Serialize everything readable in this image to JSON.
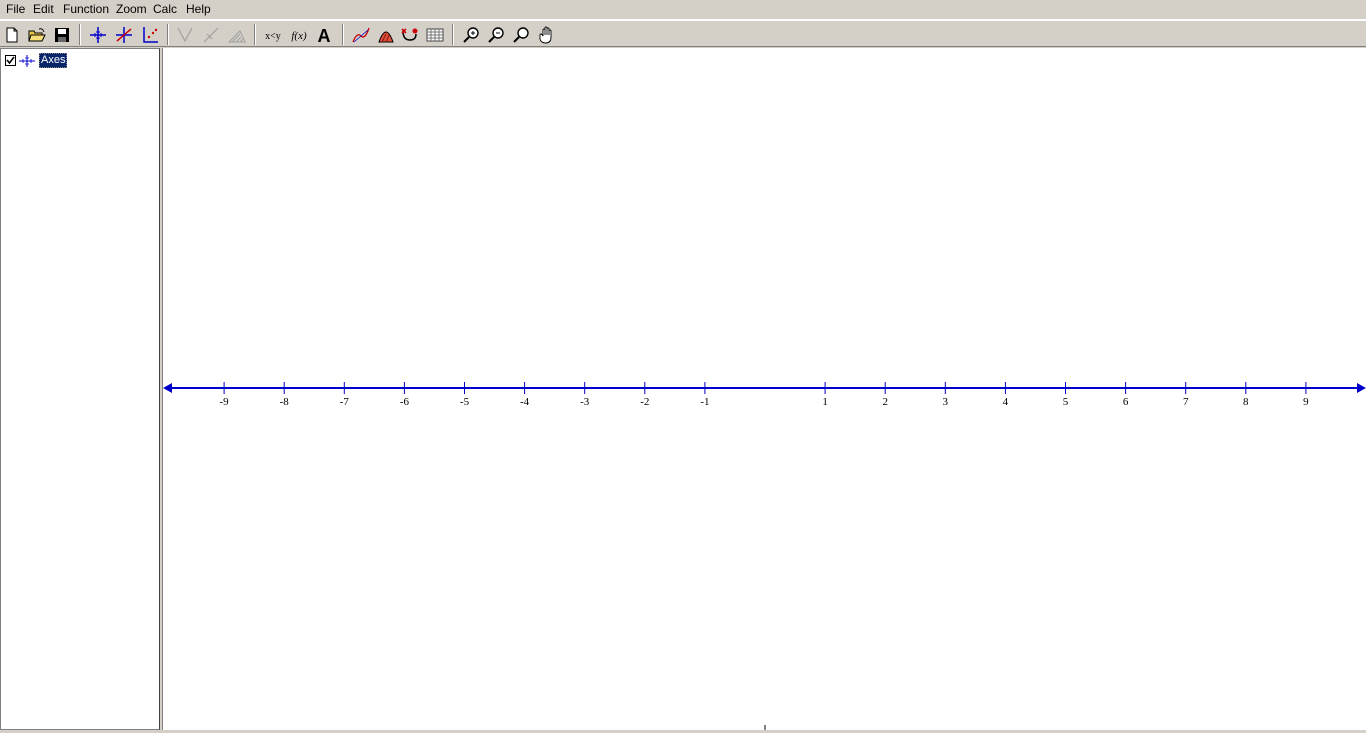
{
  "menu": [
    "File",
    "Edit",
    "Function",
    "Zoom",
    "Calc",
    "Help"
  ],
  "toolbar": {
    "buttons": [
      {
        "name": "new-file-icon"
      },
      {
        "name": "open-folder-icon"
      },
      {
        "name": "save-disk-icon"
      },
      {
        "name": "axes-icon"
      },
      {
        "name": "insert-function-icon"
      },
      {
        "name": "point-series-icon"
      },
      {
        "name": "tangent-icon"
      },
      {
        "name": "normal-icon"
      },
      {
        "name": "shading-icon"
      },
      {
        "name": "relation-icon"
      },
      {
        "name": "custom-function-icon"
      },
      {
        "name": "text-label-icon"
      },
      {
        "name": "trendline-icon"
      },
      {
        "name": "shade-area-icon"
      },
      {
        "name": "evaluate-icon"
      },
      {
        "name": "table-icon"
      },
      {
        "name": "zoom-in-icon"
      },
      {
        "name": "zoom-out-icon"
      },
      {
        "name": "zoom-standard-icon"
      },
      {
        "name": "pan-hand-icon"
      }
    ],
    "relation_label": "x<y",
    "function_label": "f(x)",
    "text_label": "A"
  },
  "tree": {
    "items": [
      {
        "label": "Axes",
        "checked": true
      }
    ]
  },
  "axis": {
    "color": "#0000cc",
    "x_min": -10,
    "x_max": 10,
    "tick_values": [
      -9,
      -8,
      -7,
      -6,
      -5,
      -4,
      -3,
      -2,
      -1,
      1,
      2,
      3,
      4,
      5,
      6,
      7,
      8,
      9
    ],
    "tick_labels": [
      "-9",
      "-8",
      "-7",
      "-6",
      "-5",
      "-4",
      "-3",
      "-2",
      "-1",
      "1",
      "2",
      "3",
      "4",
      "5",
      "6",
      "7",
      "8",
      "9"
    ]
  }
}
